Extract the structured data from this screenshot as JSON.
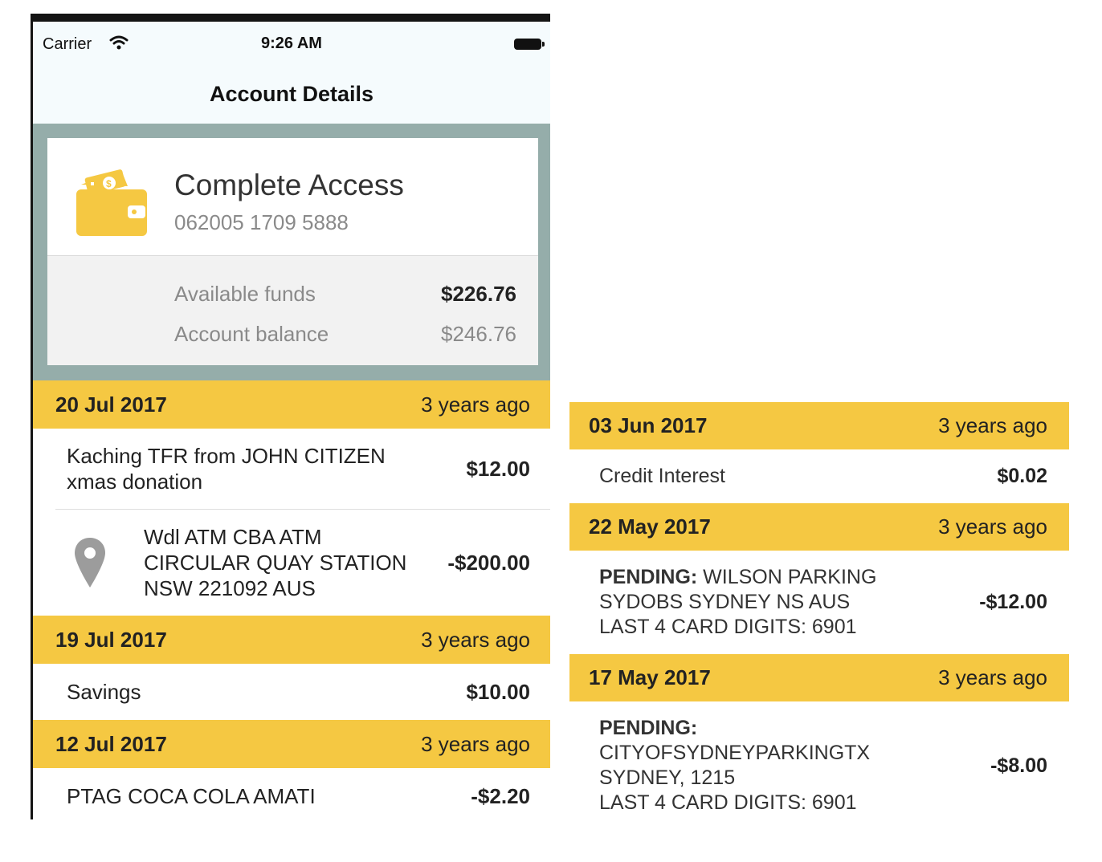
{
  "status_bar": {
    "carrier": "Carrier",
    "time": "9:26 AM"
  },
  "nav": {
    "title": "Account Details"
  },
  "account": {
    "name": "Complete Access",
    "number": "062005 1709 5888",
    "available_label": "Available funds",
    "available_value": "$226.76",
    "balance_label": "Account balance",
    "balance_value": "$246.76"
  },
  "left_groups": [
    {
      "date": "20 Jul 2017",
      "ago": "3 years ago",
      "txns": [
        {
          "desc_line1": "Kaching TFR from JOHN CITIZEN",
          "desc_line2": "xmas donation",
          "amount": "$12.00"
        },
        {
          "desc_line1": "Wdl ATM CBA ATM",
          "desc_line2": "CIRCULAR QUAY STATION",
          "desc_line3": "NSW 221092 AUS",
          "amount": "-$200.00",
          "icon": "location-pin-icon"
        }
      ]
    },
    {
      "date": "19 Jul 2017",
      "ago": "3 years ago",
      "txns": [
        {
          "desc_line1": "Savings",
          "amount": "$10.00"
        }
      ]
    },
    {
      "date": "12 Jul 2017",
      "ago": "3 years ago",
      "txns": [
        {
          "desc_line1": "PTAG COCA COLA AMATI",
          "amount": "-$2.20"
        }
      ]
    }
  ],
  "right_groups": [
    {
      "date": "03 Jun 2017",
      "ago": "3 years ago",
      "txns": [
        {
          "desc_line1": "Credit Interest",
          "amount": "$0.02"
        }
      ]
    },
    {
      "date": "22 May 2017",
      "ago": "3 years ago",
      "txns": [
        {
          "prefix": "PENDING:",
          "desc_line1": " WILSON PARKING",
          "desc_line2": "SYDOBS SYDNEY NS AUS",
          "desc_line3": "LAST 4 CARD DIGITS: 6901",
          "amount": "-$12.00"
        }
      ]
    },
    {
      "date": "17 May 2017",
      "ago": "3 years ago",
      "txns": [
        {
          "prefix": "PENDING:",
          "desc_line2": "CITYOFSYDNEYPARKINGTX",
          "desc_line3": "SYDNEY, 1215",
          "desc_line4": "LAST 4 CARD DIGITS: 6901",
          "amount": "-$8.00"
        }
      ]
    }
  ],
  "colors": {
    "accent": "#f5c842",
    "hero_bg": "#95adaa",
    "icon": "#f5c842"
  }
}
